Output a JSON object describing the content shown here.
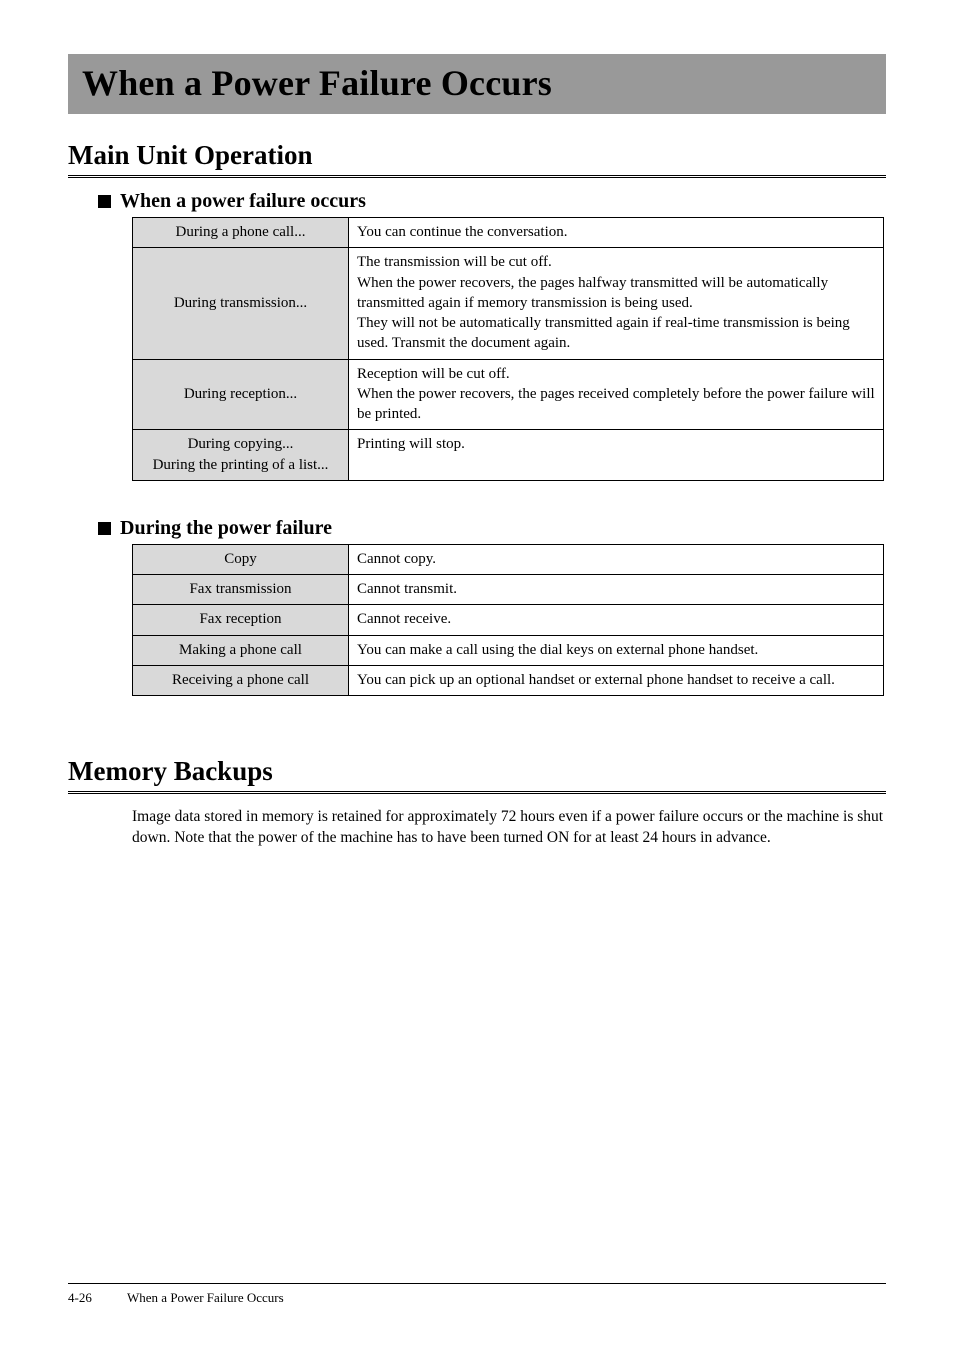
{
  "page_title": "When a Power Failure Occurs",
  "sections": {
    "main_unit": {
      "heading": "Main Unit Operation",
      "sub1": {
        "heading": "When a power failure occurs",
        "rows": [
          {
            "left": "During a phone call...",
            "right": "You can continue the conversation."
          },
          {
            "left": "During transmission...",
            "right": "The transmission will be cut off.\nWhen the power recovers, the pages halfway transmitted will be automatically transmitted again if memory transmission is being used.\nThey will not be automatically transmitted again if real-time transmission is being used. Transmit the document again."
          },
          {
            "left": "During reception...",
            "right": "Reception will be cut off.\nWhen the power recovers, the pages received completely before the power failure will be printed."
          },
          {
            "left": "During copying...\nDuring the printing of a list...",
            "right": "Printing will stop."
          }
        ]
      },
      "sub2": {
        "heading": "During the power failure",
        "rows": [
          {
            "left": "Copy",
            "right": "Cannot copy."
          },
          {
            "left": "Fax transmission",
            "right": "Cannot transmit."
          },
          {
            "left": "Fax reception",
            "right": "Cannot receive."
          },
          {
            "left": "Making a phone call",
            "right": "You can make a call using the dial keys on external phone handset."
          },
          {
            "left": "Receiving a phone call",
            "right": "You can pick up an optional handset or external phone handset to receive a call."
          }
        ]
      }
    },
    "memory": {
      "heading": "Memory Backups",
      "para": "Image data stored in memory is retained for approximately 72 hours even if a power failure occurs or the machine is shut down. Note that the power of the machine has to have been turned ON for at least 24 hours in advance."
    }
  },
  "footer": {
    "page": "4-26",
    "title": "When a Power Failure Occurs"
  }
}
